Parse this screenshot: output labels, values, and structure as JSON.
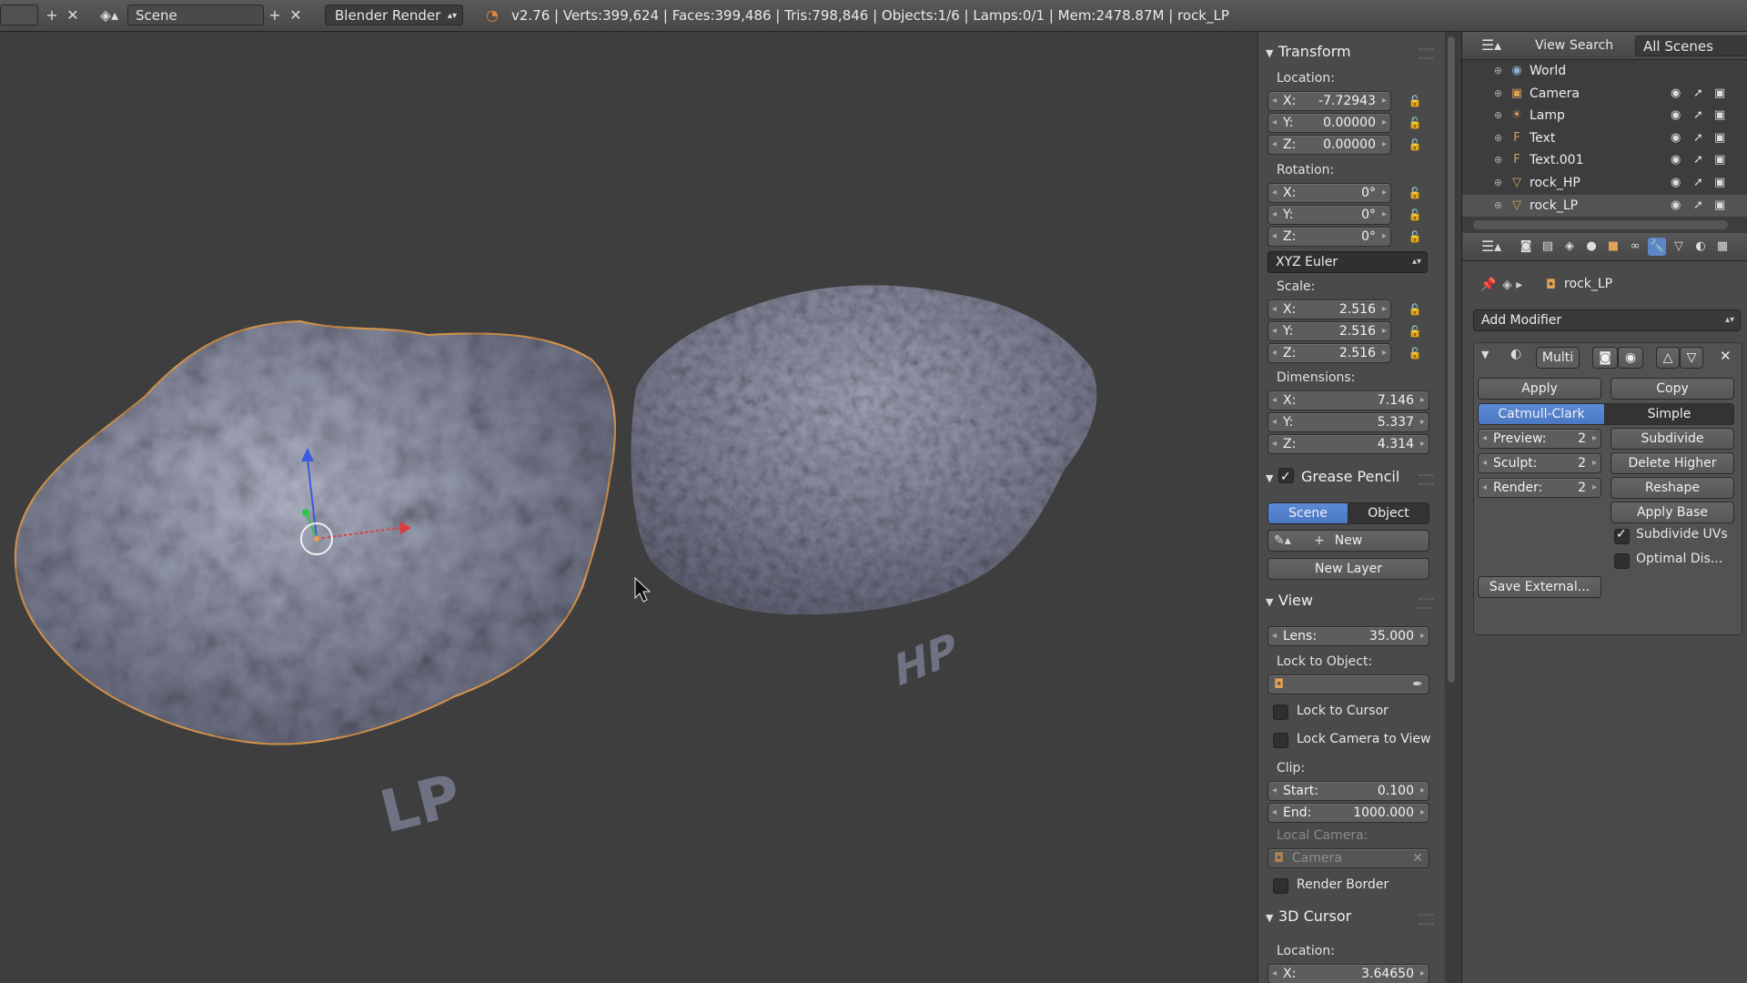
{
  "header": {
    "scene_name": "Scene",
    "render_engine": "Blender Render",
    "stats": "v2.76 | Verts:399,624 | Faces:399,486 | Tris:798,846 | Objects:1/6 | Lamps:0/1 | Mem:2478.87M | rock_LP"
  },
  "viewport": {
    "label_lp": "LP",
    "label_hp": "HP"
  },
  "npanel": {
    "transform": {
      "title": "Transform",
      "location_label": "Location:",
      "location": [
        {
          "axis": "X:",
          "value": "-7.72943"
        },
        {
          "axis": "Y:",
          "value": "0.00000"
        },
        {
          "axis": "Z:",
          "value": "0.00000"
        }
      ],
      "rotation_label": "Rotation:",
      "rotation": [
        {
          "axis": "X:",
          "value": "0°"
        },
        {
          "axis": "Y:",
          "value": "0°"
        },
        {
          "axis": "Z:",
          "value": "0°"
        }
      ],
      "rotation_mode": "XYZ Euler",
      "scale_label": "Scale:",
      "scale": [
        {
          "axis": "X:",
          "value": "2.516"
        },
        {
          "axis": "Y:",
          "value": "2.516"
        },
        {
          "axis": "Z:",
          "value": "2.516"
        }
      ],
      "dimensions_label": "Dimensions:",
      "dimensions": [
        {
          "axis": "X:",
          "value": "7.146"
        },
        {
          "axis": "Y:",
          "value": "5.337"
        },
        {
          "axis": "Z:",
          "value": "4.314"
        }
      ]
    },
    "grease_pencil": {
      "title": "Grease Pencil",
      "scene_btn": "Scene",
      "object_btn": "Object",
      "new_btn": "New",
      "new_layer_btn": "New Layer"
    },
    "view": {
      "title": "View",
      "lens_label": "Lens:",
      "lens_value": "35.000",
      "lock_to_object_label": "Lock to Object:",
      "lock_to_cursor": "Lock to Cursor",
      "lock_camera_to_view": "Lock Camera to View",
      "clip_label": "Clip:",
      "clip_start_label": "Start:",
      "clip_start": "0.100",
      "clip_end_label": "End:",
      "clip_end": "1000.000",
      "local_camera_label": "Local Camera:",
      "local_camera": "Camera",
      "render_border": "Render Border"
    },
    "cursor": {
      "title": "3D Cursor",
      "location_label": "Location:",
      "x_axis": "X:",
      "x_value": "3.64650"
    }
  },
  "outliner": {
    "menu_view": "View",
    "menu_search": "Search",
    "display_mode": "All Scenes",
    "items": [
      {
        "name": "World",
        "icon": "world-icon",
        "glyph": "◉",
        "color": "#8fb3d9"
      },
      {
        "name": "Camera",
        "icon": "camera-icon",
        "glyph": "▣",
        "color": "#d9a05b"
      },
      {
        "name": "Lamp",
        "icon": "lamp-icon",
        "glyph": "☀",
        "color": "#d9a05b"
      },
      {
        "name": "Text",
        "icon": "text-icon",
        "glyph": "F",
        "color": "#d9a05b"
      },
      {
        "name": "Text.001",
        "icon": "text-icon",
        "glyph": "F",
        "color": "#d9a05b"
      },
      {
        "name": "rock_HP",
        "icon": "mesh-icon",
        "glyph": "▽",
        "color": "#d9a05b"
      },
      {
        "name": "rock_LP",
        "icon": "mesh-icon",
        "glyph": "▽",
        "color": "#d9a05b"
      }
    ]
  },
  "properties": {
    "breadcrumb_object": "rock_LP",
    "add_modifier": "Add Modifier",
    "modifier": {
      "name": "Multi",
      "apply_btn": "Apply",
      "copy_btn": "Copy",
      "catmull_btn": "Catmull-Clark",
      "simple_btn": "Simple",
      "preview_label": "Preview:",
      "preview_value": "2",
      "sculpt_label": "Sculpt:",
      "sculpt_value": "2",
      "render_label": "Render:",
      "render_value": "2",
      "subdivide_btn": "Subdivide",
      "delete_higher_btn": "Delete Higher",
      "reshape_btn": "Reshape",
      "apply_base_btn": "Apply Base",
      "subdivide_uvs": "Subdivide UVs",
      "optimal_display": "Optimal Dis...",
      "save_external_btn": "Save External..."
    }
  },
  "colors": {
    "accent_blue": "#5c8ad6",
    "selection_outline": "#e8a050",
    "viewport_bg": "#3e3e3e"
  }
}
